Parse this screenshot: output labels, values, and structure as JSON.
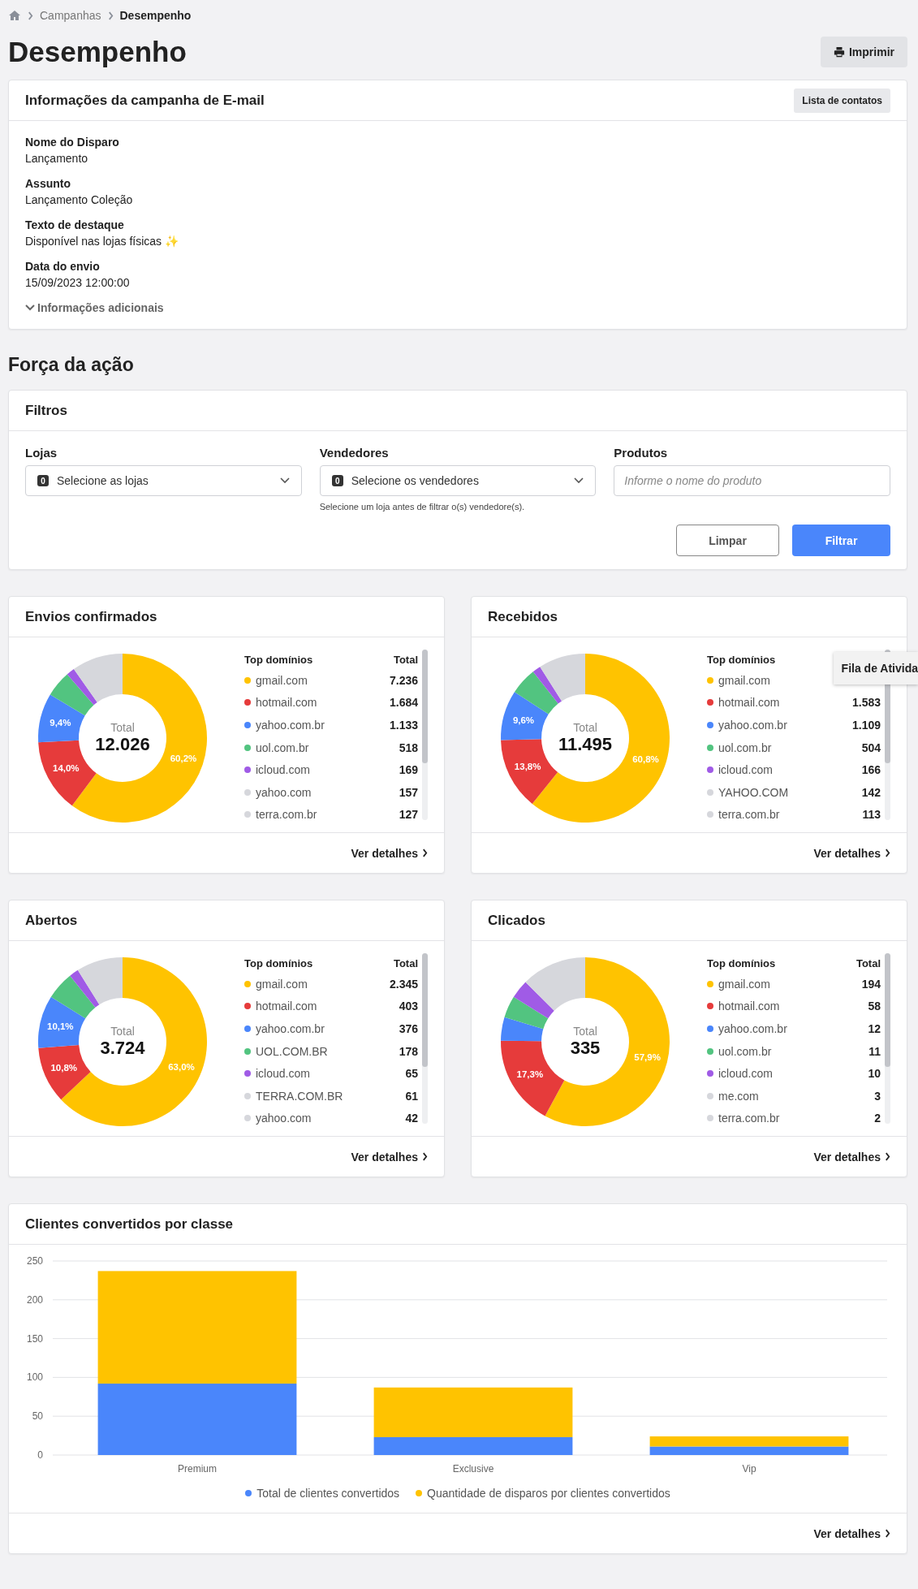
{
  "breadcrumb": [
    {
      "label": "Campanhas",
      "current": false
    },
    {
      "label": "Desempenho",
      "current": true
    }
  ],
  "title": "Desempenho",
  "print_button": "Imprimir",
  "campaign_info": {
    "title": "Informações da campanha de E-mail",
    "contacts_button": "Lista de contatos",
    "fields": [
      {
        "label": "Nome do Disparo",
        "value": "Lançamento"
      },
      {
        "label": "Assunto",
        "value": "Lançamento Coleção"
      },
      {
        "label": "Texto de destaque",
        "value": "Disponível nas lojas físicas ✨"
      },
      {
        "label": "Data do envio",
        "value": "15/09/2023 12:00:00"
      }
    ],
    "more_info": {
      "label": "Informações adicionais",
      "expanded": false
    }
  },
  "section_title": "Força da ação",
  "filters": {
    "title": "Filtros",
    "fields": [
      {
        "kind": "select",
        "label": "Lojas",
        "badge": "0",
        "placeholder": "Selecione as lojas"
      },
      {
        "kind": "select",
        "label": "Vendedores",
        "badge": "0",
        "placeholder": "Selecione os vendedores",
        "hint": "Selecione um loja antes de filtrar o(s) vendedore(s)."
      },
      {
        "kind": "input",
        "label": "Produtos",
        "placeholder": "Informe o nome do produto"
      }
    ],
    "clear_button": "Limpar",
    "filter_button": "Filtrar"
  },
  "metric_cards": [
    {
      "title": "Envios confirmados",
      "center_label": "Total",
      "center_value": "12.026",
      "domain_heading": "Top domínios",
      "total_heading": "Total",
      "link": "Ver detalhes",
      "domains": [
        {
          "name": "gmail.com",
          "total": "7.236",
          "color": "#ffc300"
        },
        {
          "name": "hotmail.com",
          "total": "1.684",
          "color": "#e63b3b"
        },
        {
          "name": "yahoo.com.br",
          "total": "1.133",
          "color": "#4a86fb"
        },
        {
          "name": "uol.com.br",
          "total": "518",
          "color": "#52c480"
        },
        {
          "name": "icloud.com",
          "total": "169",
          "color": "#a05be6"
        },
        {
          "name": "yahoo.com",
          "total": "157",
          "color": "#d6d7dc"
        },
        {
          "name": "terra.com.br",
          "total": "127",
          "color": "#d6d7dc"
        }
      ],
      "chart_data": {
        "type": "donut",
        "values": [
          60.2,
          14.0,
          9.4,
          5.0,
          1.6,
          9.8
        ],
        "value_labels": [
          "60,2%",
          "14,0%",
          "9,4%",
          null,
          null,
          null
        ]
      }
    },
    {
      "title": "Recebidos",
      "center_label": "Total",
      "center_value": "11.495",
      "domain_heading": "Top domínios",
      "link": "Ver detalhes",
      "tooltip": "Fila de Ativida",
      "domains": [
        {
          "name": "gmail.com",
          "color": "#ffc300"
        },
        {
          "name": "hotmail.com",
          "total": "1.583",
          "color": "#e63b3b"
        },
        {
          "name": "yahoo.com.br",
          "total": "1.109",
          "color": "#4a86fb"
        },
        {
          "name": "uol.com.br",
          "total": "504",
          "color": "#52c480"
        },
        {
          "name": "icloud.com",
          "total": "166",
          "color": "#a05be6"
        },
        {
          "name": "YAHOO.COM",
          "total": "142",
          "color": "#d6d7dc"
        },
        {
          "name": "terra.com.br",
          "total": "113",
          "color": "#d6d7dc"
        }
      ],
      "chart_data": {
        "type": "donut",
        "values": [
          60.8,
          13.8,
          9.6,
          5.2,
          1.6,
          9.0
        ],
        "value_labels": [
          "60,8%",
          "13,8%",
          "9,6%",
          null,
          null,
          null
        ]
      }
    },
    {
      "title": "Abertos",
      "center_label": "Total",
      "center_value": "3.724",
      "domain_heading": "Top domínios",
      "total_heading": "Total",
      "link": "Ver detalhes",
      "domains": [
        {
          "name": "gmail.com",
          "total": "2.345",
          "color": "#ffc300"
        },
        {
          "name": "hotmail.com",
          "total": "403",
          "color": "#e63b3b"
        },
        {
          "name": "yahoo.com.br",
          "total": "376",
          "color": "#4a86fb"
        },
        {
          "name": "UOL.COM.BR",
          "total": "178",
          "color": "#52c480"
        },
        {
          "name": "icloud.com",
          "total": "65",
          "color": "#a05be6"
        },
        {
          "name": "TERRA.COM.BR",
          "total": "61",
          "color": "#d6d7dc"
        },
        {
          "name": "yahoo.com",
          "total": "42",
          "color": "#d6d7dc"
        }
      ],
      "chart_data": {
        "type": "donut",
        "values": [
          63.0,
          10.8,
          10.1,
          5.4,
          1.8,
          8.9
        ],
        "value_labels": [
          "63,0%",
          "10,8%",
          "10,1%",
          null,
          null,
          null
        ]
      }
    },
    {
      "title": "Clicados",
      "center_label": "Total",
      "center_value": "335",
      "domain_heading": "Top domínios",
      "total_heading": "Total",
      "link": "Ver detalhes",
      "domains": [
        {
          "name": "gmail.com",
          "total": "194",
          "color": "#ffc300"
        },
        {
          "name": "hotmail.com",
          "total": "58",
          "color": "#e63b3b"
        },
        {
          "name": "yahoo.com.br",
          "total": "12",
          "color": "#4a86fb"
        },
        {
          "name": "uol.com.br",
          "total": "11",
          "color": "#52c480"
        },
        {
          "name": "icloud.com",
          "total": "10",
          "color": "#a05be6"
        },
        {
          "name": "me.com",
          "total": "3",
          "color": "#d6d7dc"
        },
        {
          "name": "terra.com.br",
          "total": "2",
          "color": "#d6d7dc"
        }
      ],
      "chart_data": {
        "type": "donut",
        "values": [
          57.9,
          17.3,
          4.5,
          4.2,
          3.6,
          12.5
        ],
        "value_labels": [
          "57,9%",
          "17,3%",
          null,
          null,
          null,
          null
        ]
      }
    }
  ],
  "conversion_card": {
    "title": "Clientes convertidos por classe",
    "link": "Ver detalhes",
    "chart_data": {
      "type": "bar",
      "categories": [
        "Premium",
        "Exclusive",
        "Vip"
      ],
      "stacked": true,
      "grid": true,
      "legend": true,
      "ylim": [
        0,
        250
      ],
      "yticks": [
        0,
        50,
        100,
        150,
        200,
        250
      ],
      "series": [
        {
          "name": "Total de clientes convertidos",
          "color": "#4a86fb",
          "values": [
            92,
            23,
            11
          ]
        },
        {
          "name": "Quantidade de disparos por clientes convertidos",
          "color": "#ffc300",
          "values": [
            145,
            64,
            13
          ]
        }
      ]
    }
  }
}
